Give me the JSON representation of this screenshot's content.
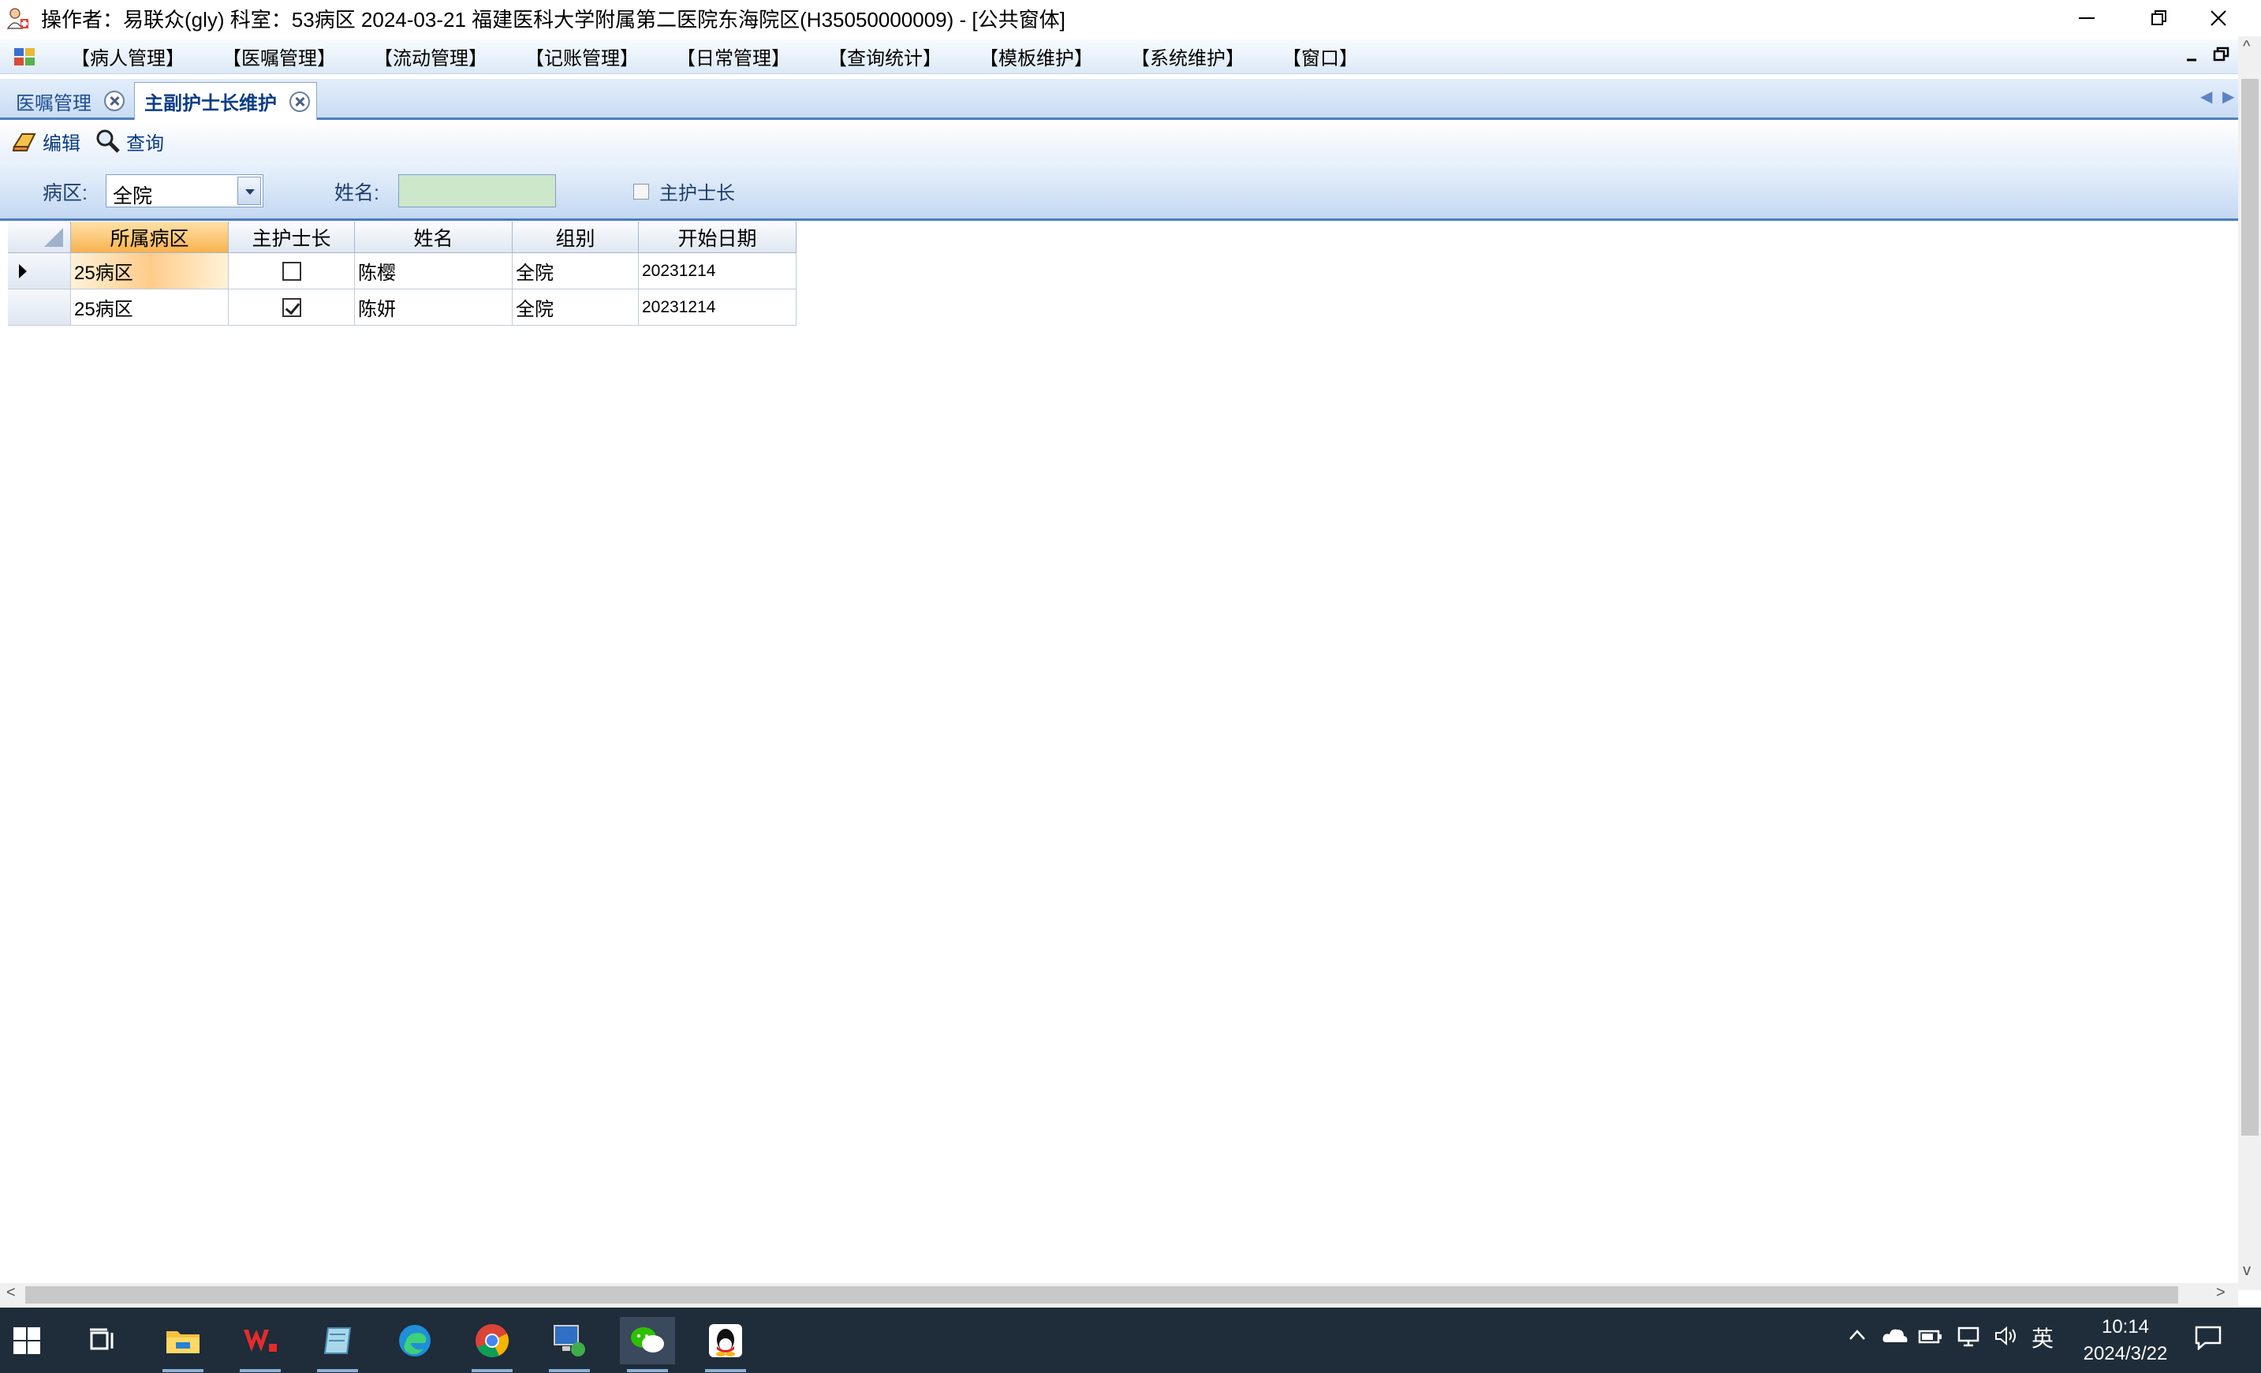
{
  "window": {
    "title": "操作者：易联众(gly)  科室：53病区  2024-03-21  福建医科大学附属第二医院东海院区(H35050000009) - [公共窗体]"
  },
  "menu": {
    "items": [
      "【病人管理】",
      "【医嘱管理】",
      "【流动管理】",
      "【记账管理】",
      "【日常管理】",
      "【查询统计】",
      "【模板维护】",
      "【系统维护】",
      "【窗口】"
    ]
  },
  "tabs": [
    {
      "label": "医嘱管理",
      "active": false
    },
    {
      "label": "主副护士长维护",
      "active": true
    }
  ],
  "toolbar": {
    "edit_label": "编辑",
    "query_label": "查询"
  },
  "filters": {
    "ward_label": "病区:",
    "ward_value": "全院",
    "name_label": "姓名:",
    "name_value": "",
    "head_nurse_label": "主护士长",
    "head_nurse_checked": false
  },
  "grid": {
    "columns": [
      "所属病区",
      "主护士长",
      "姓名",
      "组别",
      "开始日期"
    ],
    "rows": [
      {
        "ward": "25病区",
        "head_nurse": false,
        "name": "陈樱",
        "group": "全院",
        "start_date": "20231214",
        "selected": true
      },
      {
        "ward": "25病区",
        "head_nurse": true,
        "name": "陈妍",
        "group": "全院",
        "start_date": "20231214",
        "selected": false
      }
    ]
  },
  "taskbar": {
    "apps": [
      "start-icon",
      "task-view-icon",
      "file-explorer-icon",
      "wps-icon",
      "notepad-icon",
      "edge-icon",
      "chrome-icon",
      "remote-desktop-icon",
      "wechat-icon",
      "qq-icon"
    ],
    "ime": "英",
    "time": "10:14",
    "date": "2024/3/22"
  },
  "colors": {
    "accent": "#4c7cbf",
    "selected_row": "#ffcc8a",
    "name_input_bg": "#cce7c9",
    "taskbar_bg": "#1f2c3a"
  }
}
